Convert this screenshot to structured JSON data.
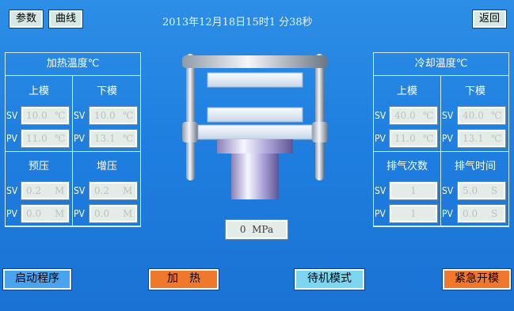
{
  "top": {
    "params_label": "参数",
    "curve_label": "曲线",
    "datetime": "2013年12月18日15时1  分38秒",
    "back_label": "返回"
  },
  "heating": {
    "title": "加热温度℃",
    "upper_label": "上模",
    "lower_label": "下模",
    "sv_label": "SV",
    "pv_label": "PV",
    "upper_sv": "10.0",
    "upper_pv": "11.0",
    "lower_sv": "10.0",
    "lower_pv": "13.1",
    "temp_unit": "℃",
    "prepress_label": "预压",
    "boost_label": "增压",
    "prepress_sv": "0.2",
    "prepress_pv": "0.0",
    "boost_sv": "0.2",
    "boost_pv": "0.0",
    "press_unit": "M"
  },
  "cooling": {
    "title": "冷却温度℃",
    "upper_label": "上模",
    "lower_label": "下模",
    "sv_label": "SV",
    "pv_label": "PV",
    "upper_sv": "40.0",
    "upper_pv": "11.0",
    "lower_sv": "40.0",
    "lower_pv": "13.1",
    "temp_unit": "℃",
    "exhaust_count_label": "排气次数",
    "exhaust_time_label": "排气时间",
    "exhaust_count_sv": "1",
    "exhaust_count_pv": "1",
    "exhaust_time_sv": "5.0",
    "exhaust_time_pv": "0.0",
    "time_unit": "S"
  },
  "pressure": {
    "value": "0",
    "unit": "MPa"
  },
  "buttons": {
    "start_program": "启动程序",
    "heat": "加　热",
    "standby_mode": "待机模式",
    "emergency_open": "紧急开模"
  },
  "colors": {
    "background": "#1f7fe0",
    "start_button": "#4aa3ee",
    "heat_button": "#f0782c",
    "standby_button": "#7cd6f2",
    "emergency_button": "#f0782c",
    "field_bg": "#e4ece8"
  }
}
